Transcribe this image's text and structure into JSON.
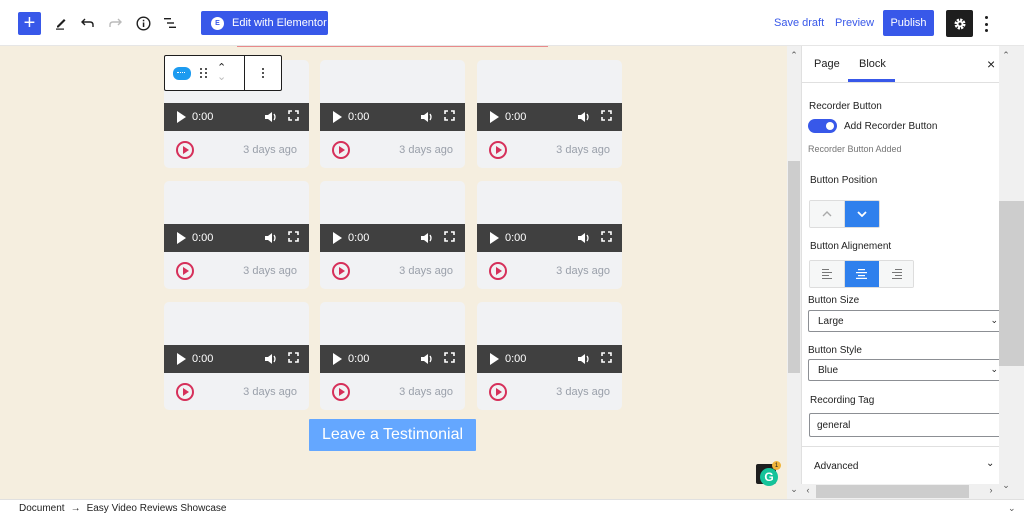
{
  "topbar": {
    "add_block_label": "+",
    "tools": [
      "pencil-icon",
      "undo-icon",
      "redo-icon",
      "info-icon",
      "list-view-icon"
    ],
    "elementor_button": "Edit with Elementor",
    "elementor_badge": "E",
    "save_draft": "Save draft",
    "preview": "Preview",
    "publish": "Publish"
  },
  "editor": {
    "block_toolbar": {
      "block_icon": "video-review-block-icon"
    },
    "cards": [
      {
        "time": "0:00",
        "ago": "3 days ago"
      },
      {
        "time": "0:00",
        "ago": "3 days ago"
      },
      {
        "time": "0:00",
        "ago": "3 days ago"
      },
      {
        "time": "0:00",
        "ago": "3 days ago"
      },
      {
        "time": "0:00",
        "ago": "3 days ago"
      },
      {
        "time": "0:00",
        "ago": "3 days ago"
      },
      {
        "time": "0:00",
        "ago": "3 days ago"
      },
      {
        "time": "0:00",
        "ago": "3 days ago"
      },
      {
        "time": "0:00",
        "ago": "3 days ago"
      }
    ],
    "testimonial_button": "Leave a Testimonial",
    "grammarly": {
      "letter": "G",
      "count": "1"
    }
  },
  "sidebar": {
    "tabs": [
      {
        "label": "Page"
      },
      {
        "label": "Block"
      }
    ],
    "active_tab": "Block",
    "close": "×",
    "recorder_button": {
      "heading": "Recorder Button",
      "toggle_label": "Add Recorder Button",
      "toggle_on": true,
      "help": "Recorder Button Added"
    },
    "button_position": {
      "label": "Button Position",
      "selected": "down"
    },
    "button_alignment": {
      "label": "Button Alignement",
      "selected": "center"
    },
    "button_size": {
      "label": "Button Size",
      "value": "Large"
    },
    "button_style": {
      "label": "Button Style",
      "value": "Blue"
    },
    "recording_tag": {
      "label": "Recording Tag",
      "value": "general"
    },
    "advanced": {
      "label": "Advanced"
    }
  },
  "footer": {
    "breadcrumb": [
      "Document",
      "Easy Video Reviews Showcase"
    ],
    "separator": "→"
  },
  "colors": {
    "accent": "#3858e9",
    "canvas_bg": "#f5eedf",
    "record_red": "#d6305a",
    "testimonial_blue": "#64a7ff"
  }
}
